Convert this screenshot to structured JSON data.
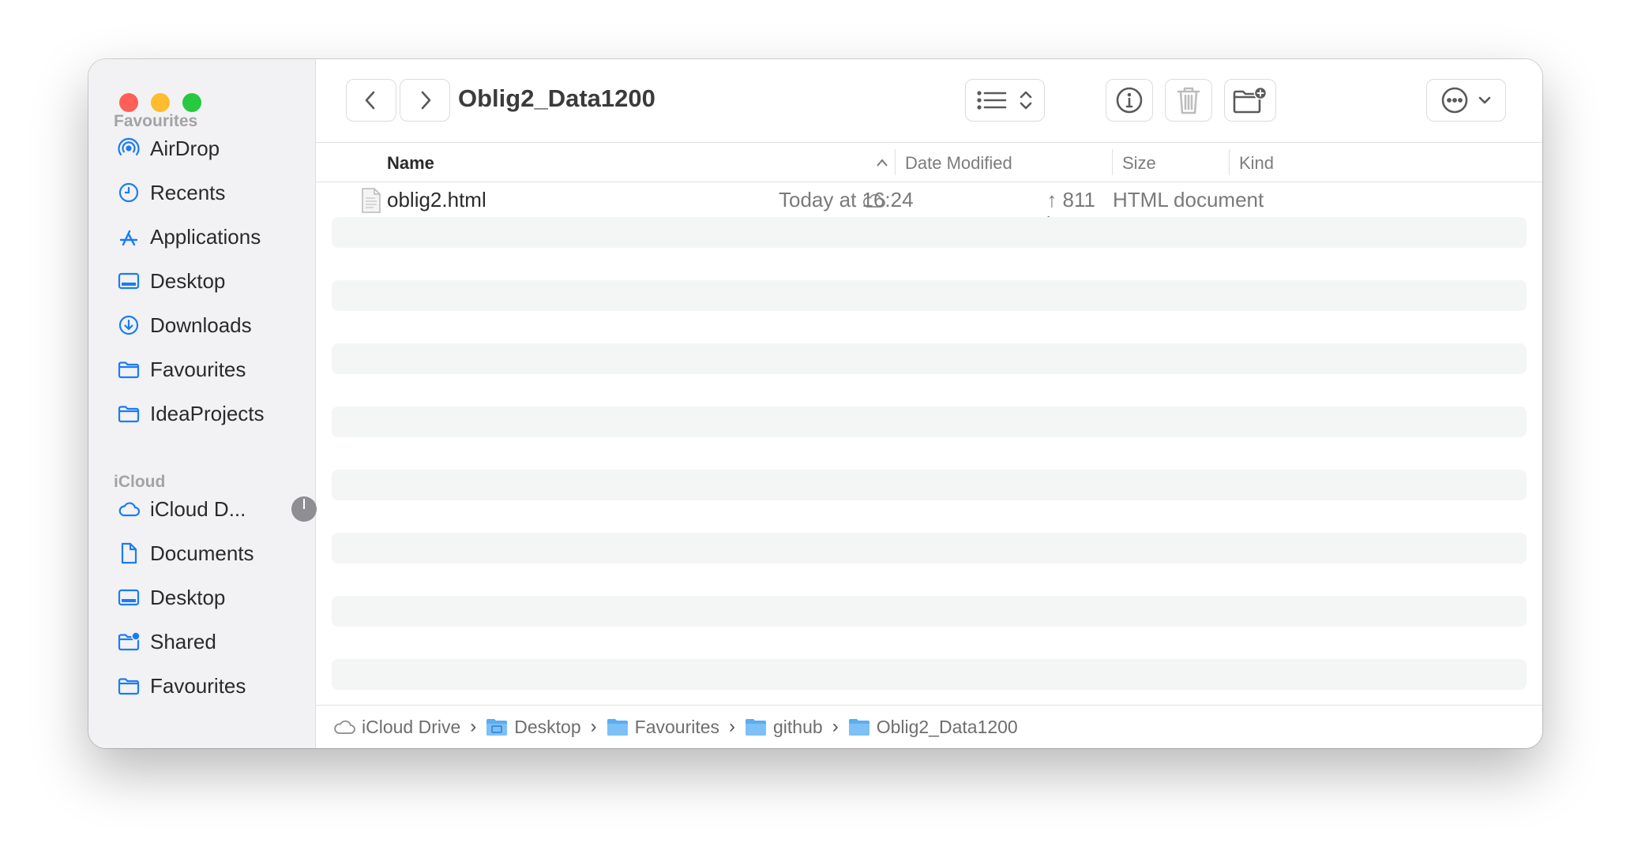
{
  "window": {
    "title": "Oblig2_Data1200"
  },
  "sidebar": {
    "favourites_heading": "Favourites",
    "favourites": [
      {
        "label": "AirDrop",
        "icon": "airdrop-icon"
      },
      {
        "label": "Recents",
        "icon": "clock-icon"
      },
      {
        "label": "Applications",
        "icon": "applications-icon"
      },
      {
        "label": "Desktop",
        "icon": "desktop-icon"
      },
      {
        "label": "Downloads",
        "icon": "download-icon"
      },
      {
        "label": "Favourites",
        "icon": "folder-icon"
      },
      {
        "label": "IdeaProjects",
        "icon": "folder-icon"
      }
    ],
    "icloud_heading": "iCloud",
    "icloud": [
      {
        "label": "iCloud D...",
        "icon": "cloud-icon"
      },
      {
        "label": "Documents",
        "icon": "document-icon"
      },
      {
        "label": "Desktop",
        "icon": "desktop-icon"
      },
      {
        "label": "Shared",
        "icon": "shared-folder-icon"
      },
      {
        "label": "Favourites",
        "icon": "folder-icon"
      }
    ]
  },
  "columns": {
    "name": "Name",
    "date": "Date Modified",
    "size": "Size",
    "kind": "Kind"
  },
  "files": [
    {
      "name": "oblig2.html",
      "date": "Today at 16:24",
      "size": "↑ 811 bytes",
      "kind": "HTML document"
    }
  ],
  "path": [
    "iCloud Drive",
    "Desktop",
    "Favourites",
    "github",
    "Oblig2_Data1200"
  ],
  "colors": {
    "accent": "#1a7cf5",
    "close": "#fe5f57",
    "minimize": "#febc2e",
    "zoom": "#28c840"
  }
}
